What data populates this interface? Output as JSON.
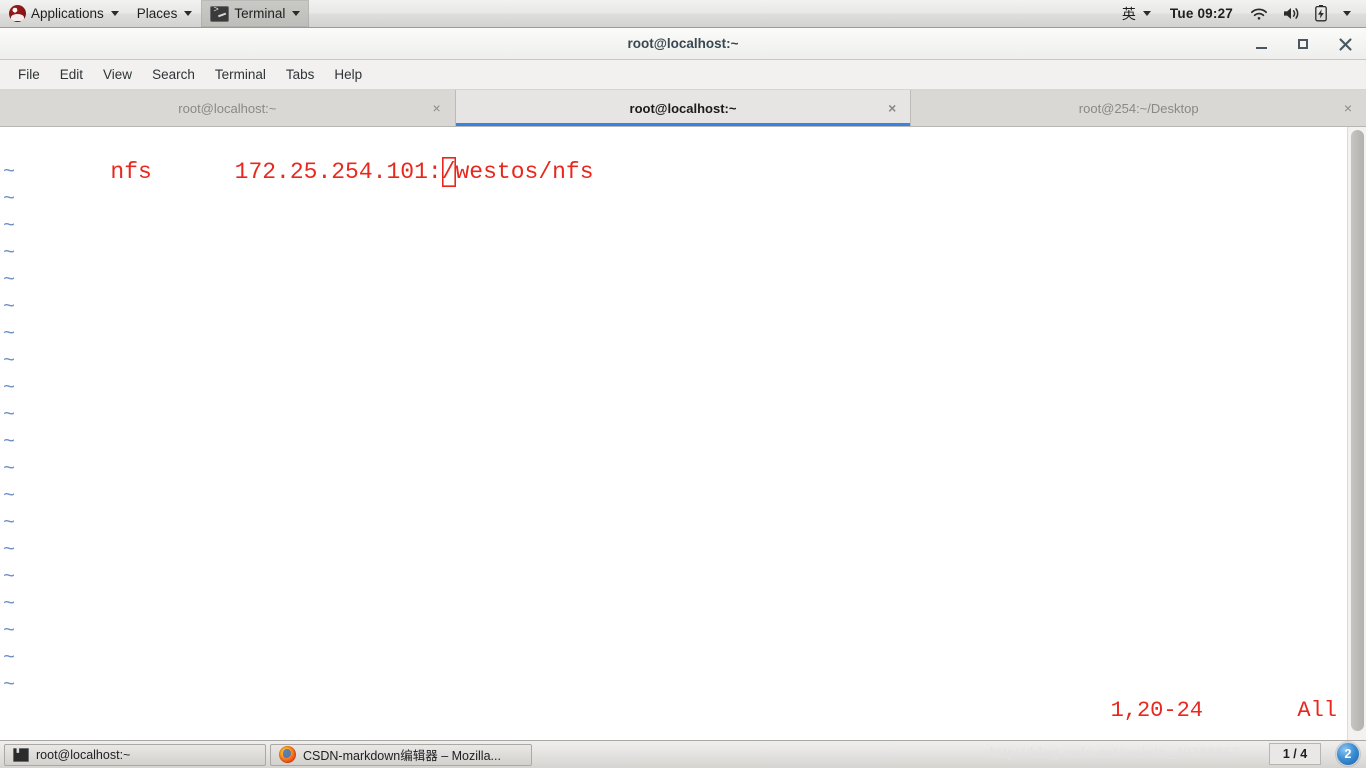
{
  "top_panel": {
    "logo_icon": "redhat-logo-icon",
    "applications_label": "Applications",
    "places_label": "Places",
    "active_app_label": "Terminal",
    "active_app_icon": "terminal-icon",
    "input_method_label": "英",
    "clock": "Tue 09:27",
    "wifi_icon": "wifi-icon",
    "volume_icon": "volume-icon",
    "battery_icon": "battery-icon",
    "system_menu_icon": "chevron-down-icon"
  },
  "window": {
    "title": "root@localhost:~",
    "controls": {
      "minimize_label": "_",
      "maximize_label": "□",
      "close_label": "×"
    },
    "menus": [
      "File",
      "Edit",
      "View",
      "Search",
      "Terminal",
      "Tabs",
      "Help"
    ],
    "tabs": [
      {
        "label": "root@localhost:~",
        "active": false,
        "close_label": "×"
      },
      {
        "label": "root@localhost:~",
        "active": true,
        "close_label": "×"
      },
      {
        "label": "root@254:~/Desktop",
        "active": false,
        "close_label": "×"
      }
    ]
  },
  "terminal": {
    "editor": "vim",
    "line_before_cursor": "nfs      172.25.254.101:",
    "cursor_char": "/",
    "line_after_cursor": "westos/nfs",
    "tilde_char": "~",
    "tilde_count": 20,
    "status_position": "1,20-24",
    "status_scroll": "All",
    "text_color": "#e8281e",
    "tilde_color": "#6d8fc9",
    "background_color": "#ffffff"
  },
  "taskbar": {
    "tasks": [
      {
        "label": "root@localhost:~",
        "icon": "terminal-icon"
      },
      {
        "label": "CSDN-markdown编辑器 – Mozilla...",
        "icon": "firefox-icon"
      }
    ],
    "watermark": "http://blog.csdn.net/weixin_40388867",
    "workspace_indicator": "1 / 4",
    "notification_count": "2"
  }
}
